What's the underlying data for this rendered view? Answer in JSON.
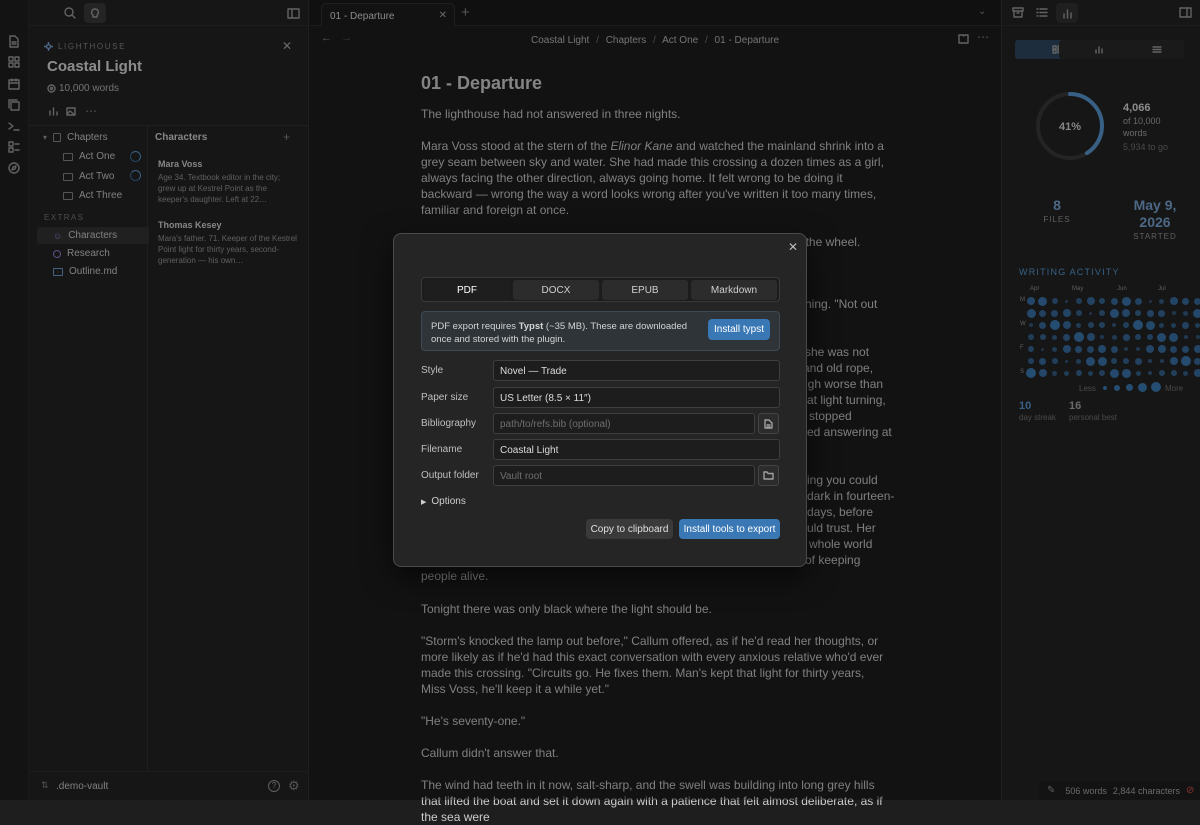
{
  "sidebar": {
    "kicker": "LIGHTHOUSE",
    "title": "Coastal Light",
    "words": "10,000 words",
    "chapters_label": "Chapters",
    "acts": [
      "Act One",
      "Act Two",
      "Act Three"
    ],
    "characters_header": "Characters",
    "characters": [
      {
        "name": "Mara Voss",
        "desc": "Age 34. Textbook editor in the city; grew up at Kestrel Point as the keeper's daughter. Left at 22…"
      },
      {
        "name": "Thomas Kesey",
        "desc": "Mara's father. 71. Keeper of the Kestrel Point light for thirty years, second-generation — his own…"
      }
    ],
    "extras_label": "EXTRAS",
    "extras": [
      "Characters",
      "Research",
      "Outline.md"
    ],
    "vault": ".demo-vault"
  },
  "tab": {
    "label": "01 - Departure"
  },
  "breadcrumb": [
    "Coastal Light",
    "Chapters",
    "Act One",
    "01 - Departure"
  ],
  "editor": {
    "heading": "01 - Departure",
    "p1": "The lighthouse had not answered in three nights.",
    "p2_a": "Mara Voss stood at the stern of the ",
    "p2_em": "Elinor Kane",
    "p2_b": " and watched the mainland shrink into a grey seam between sky and water. She had made this crossing a dozen times as a girl, always facing the other direction, always going home. It felt wrong to be doing it backward — wrong the way a word looks wrong after you've written it too many times, familiar and foreign at once.",
    "p3": "\"You'll want to go below,\" said Callum, the ferryman, not looking up from the wheel. \"Weather's",
    "frag1": "ething. \"Not out",
    "frag2": "she was not",
    "frag3": "l and old rope,",
    "frag4": "ugh worse than",
    "frag5": "at light turning,",
    "frag6": "stopped",
    "frag7": "ed answering at",
    "frag8": "ing you could",
    "frag9": "dark in fourteen-",
    "frag10": "days, before",
    "frag11": "uld trust. Her",
    "frag12": "whole world",
    "frag13": "of keeping",
    "frag14": "people alive.",
    "p5": "Tonight there was only black where the light should be.",
    "p6": "\"Storm's knocked the lamp out before,\" Callum offered, as if he'd read her thoughts, or more likely as if he'd had this exact conversation with every anxious relative who'd ever made this crossing. \"Circuits go. He fixes them. Man's kept that light for thirty years, Miss Voss, he'll keep it a while yet.\"",
    "p7": "\"He's seventy-one.\"",
    "p8": "Callum didn't answer that.",
    "p9": "The wind had teeth in it now, salt-sharp, and the swell was building into long grey hills that lifted the boat and set it down again with a patience that felt almost deliberate, as if the sea were"
  },
  "stats": {
    "percent": "41%",
    "progress": 0.41,
    "count": "4,066",
    "of_label": "of 10,000",
    "words_label": "words",
    "to_go": "5,934 to go",
    "files": "8",
    "files_label": "FILES",
    "started_date": "May 9,",
    "started_year": "2026",
    "started_label": "STARTED",
    "activity_label": "WRITING ACTIVITY",
    "months": [
      "Apr",
      "May",
      "Jun",
      "Jul"
    ],
    "days": [
      "M",
      "W",
      "F",
      "S"
    ],
    "less": "Less",
    "more": "More",
    "streak": "10",
    "streak_label": "day streak",
    "best": "16",
    "best_label": "personal best"
  },
  "modal": {
    "formats": [
      "PDF",
      "DOCX",
      "EPUB",
      "Markdown"
    ],
    "notice_a": "PDF export requires ",
    "notice_b": "Typst",
    "notice_c": " (~35 MB). These are downloaded once and stored with the plugin.",
    "install_typst": "Install typst",
    "style_label": "Style",
    "style_value": "Novel — Trade",
    "paper_label": "Paper size",
    "paper_value": "US Letter (8.5 × 11″)",
    "bib_label": "Bibliography",
    "bib_placeholder": "path/to/refs.bib (optional)",
    "filename_label": "Filename",
    "filename_value": "Coastal Light",
    "folder_label": "Output folder",
    "folder_placeholder": "Vault root",
    "options_label": "Options",
    "copy_label": "Copy to clipboard",
    "install_label": "Install tools to export"
  },
  "status": {
    "words": "506 words",
    "chars": "2,844 characters"
  },
  "colors": {
    "accent": "#5b9bd5",
    "button": "#3a78b5",
    "error": "#d9534f"
  }
}
